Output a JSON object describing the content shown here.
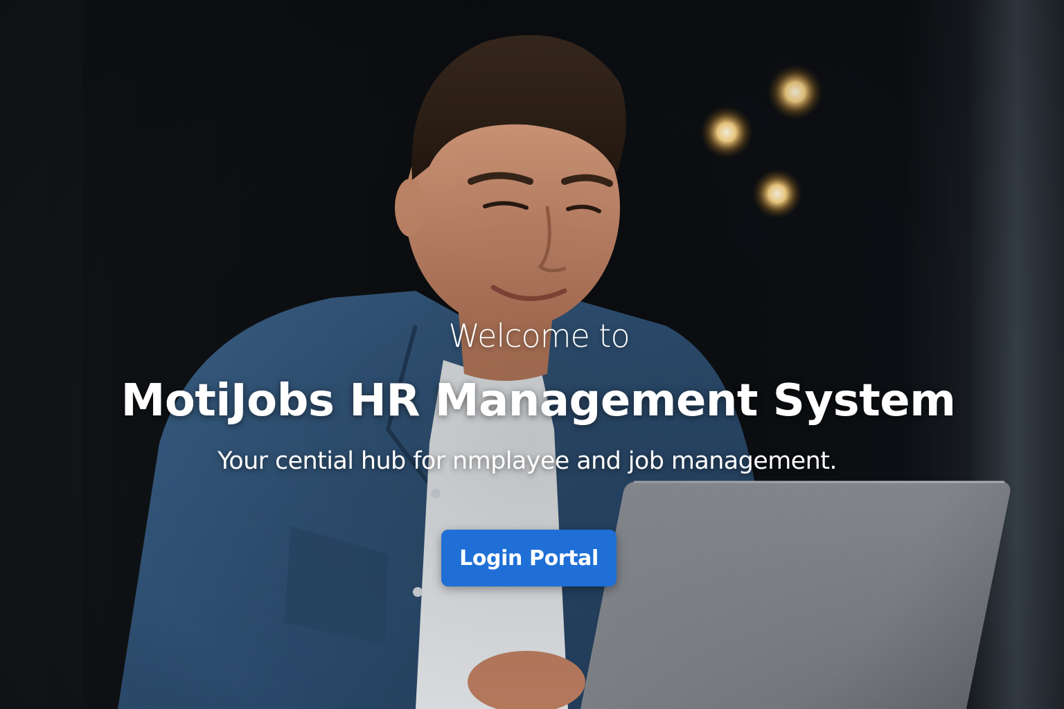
{
  "hero": {
    "welcome_text": "Welcome to",
    "title": "MotiJobs HR Management System",
    "subtitle": "Your cential hub for nmplayee and job management.",
    "login_label": "Login Portal",
    "background_image": "photo of a smiling young man in a denim shirt working on a laptop in a dim room with warm bokeh lights"
  },
  "colors": {
    "button": "#1f6fd6",
    "text": "#ffffff",
    "background": "#0c0e11"
  }
}
